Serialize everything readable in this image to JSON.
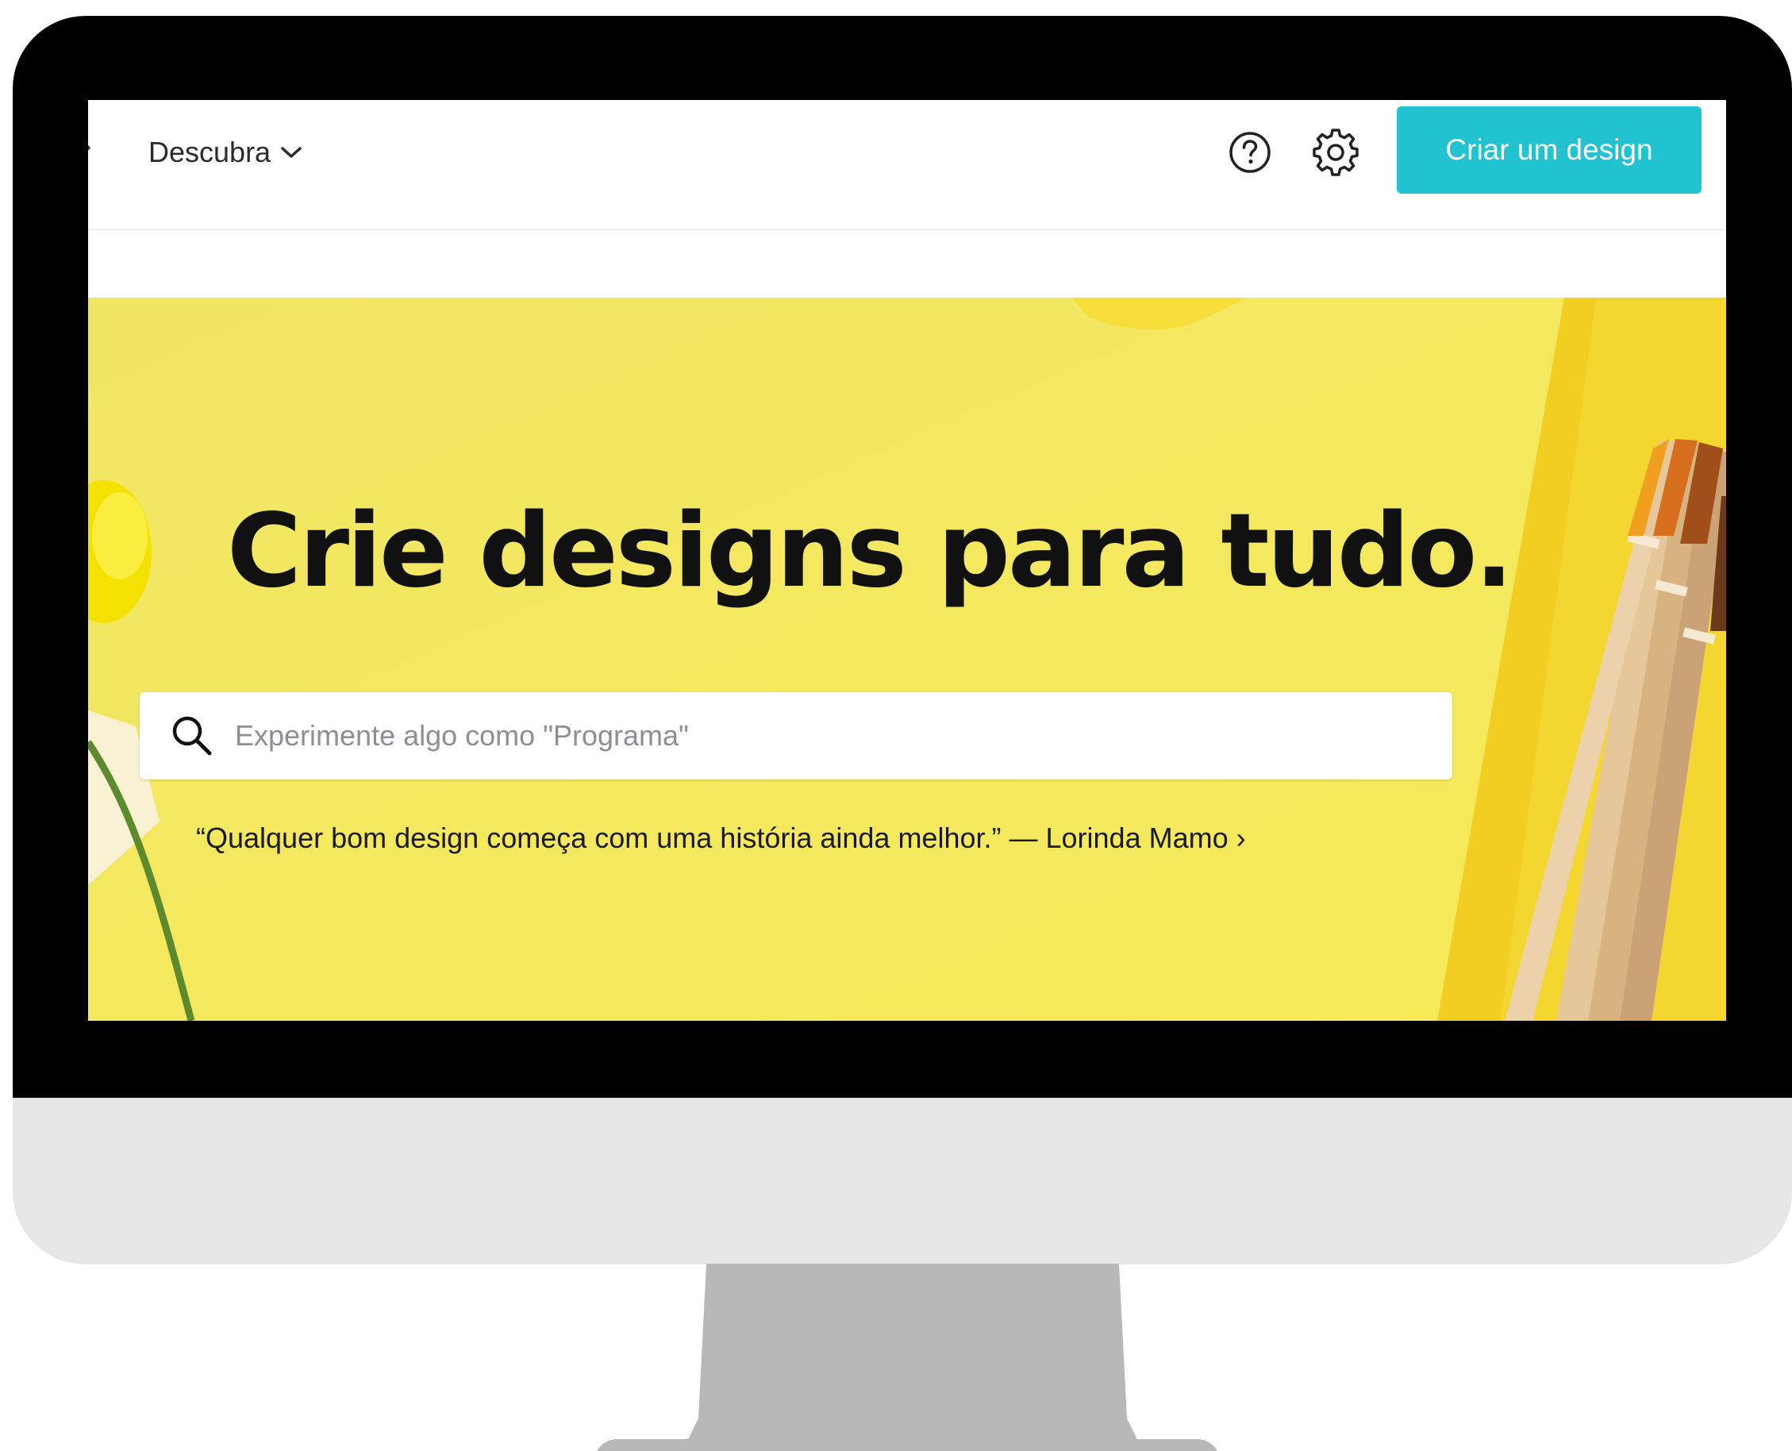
{
  "nav": {
    "discover_label": "Descubra",
    "edge_glyph": "›"
  },
  "header": {
    "help_icon": "question-circle-icon",
    "settings_icon": "gear-icon",
    "create_button_label": "Criar um design"
  },
  "hero": {
    "title": "Crie designs para tudo.",
    "search_placeholder": "Experimente algo como \"Programa\"",
    "quote": "“Qualquer bom design começa com uma história ainda melhor.” — Lorinda Mamo ›"
  },
  "colors": {
    "accent": "#20c3cf",
    "hero_background": "#f3ea5f",
    "bezel": "#000000",
    "monitor_body": "#e6e6e6",
    "stand": "#b8b8b8"
  }
}
